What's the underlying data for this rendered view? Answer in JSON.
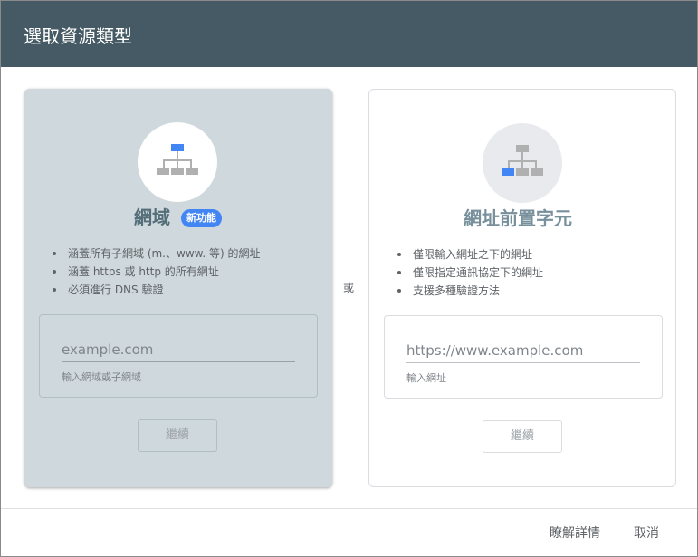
{
  "dialog": {
    "title": "選取資源類型",
    "or_label": "或"
  },
  "domain_card": {
    "title": "網域",
    "badge": "新功能",
    "bullets": [
      "涵蓋所有子網域 (m.、www. 等) 的網址",
      "涵蓋 https 或 http 的所有網址",
      "必須進行 DNS 驗證"
    ],
    "input_value": "example.com",
    "helper": "輸入網域或子網域",
    "continue_label": "繼續",
    "icon": "sitemap-icon"
  },
  "prefix_card": {
    "title": "網址前置字元",
    "bullets": [
      "僅限輸入網址之下的網址",
      "僅限指定通訊協定下的網址",
      "支援多種驗證方法"
    ],
    "input_value": "https://www.example.com",
    "helper": "輸入網址",
    "continue_label": "繼續",
    "icon": "sitemap-icon"
  },
  "footer": {
    "learn_more": "瞭解詳情",
    "cancel": "取消"
  },
  "colors": {
    "header_bg": "#455a64",
    "selected_card_bg": "#cfd8dc",
    "accent_blue": "#4285f4"
  }
}
